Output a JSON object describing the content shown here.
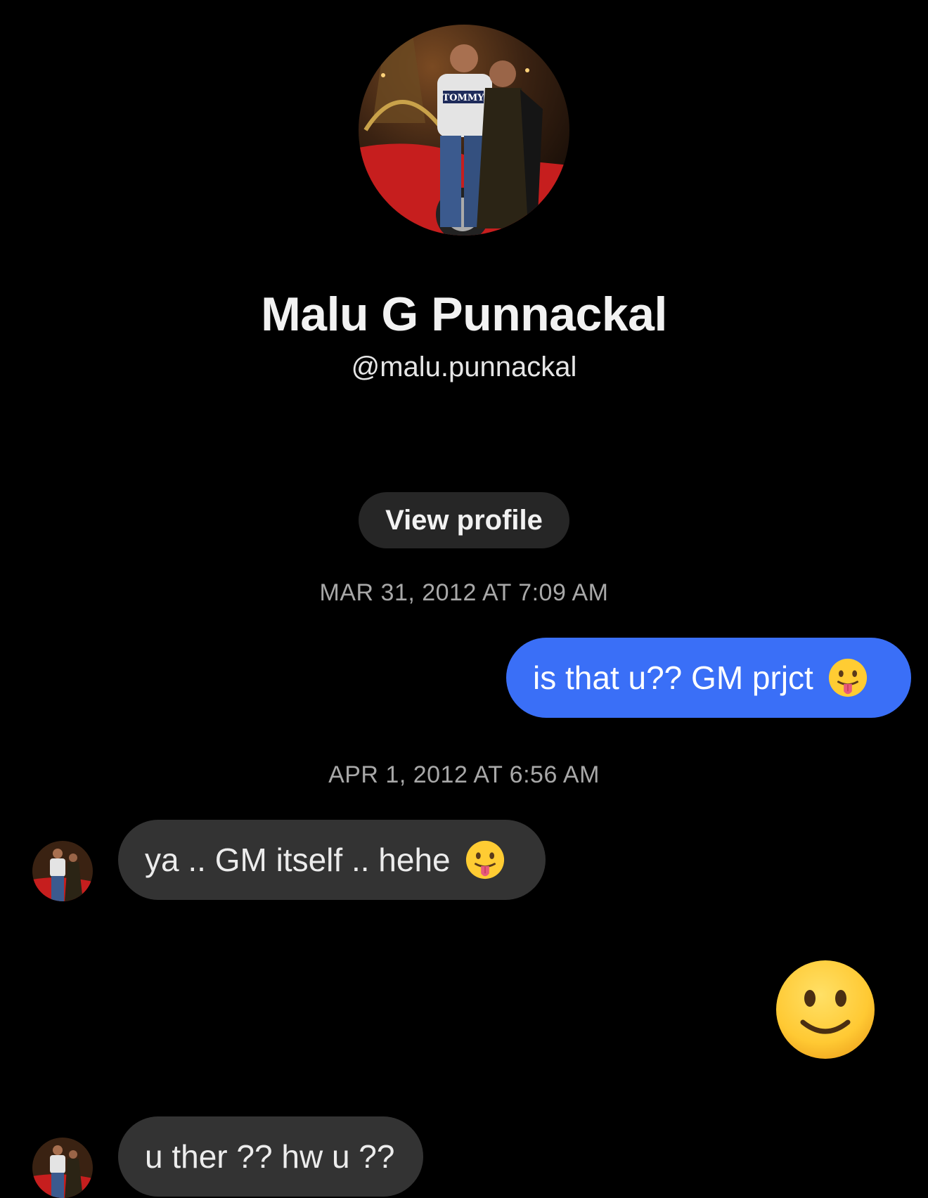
{
  "profile": {
    "name": "Malu G Punnackal",
    "handle": "@malu.punnackal",
    "photo_text": "TOMMY",
    "view_profile_label": "View profile"
  },
  "messages": [
    {
      "type": "timestamp",
      "text": "MAR 31, 2012 AT 7:09 AM"
    },
    {
      "type": "sent",
      "text": "is that u?? GM prjct",
      "emoji": "face-with-tongue"
    },
    {
      "type": "timestamp",
      "text": "APR 1, 2012 AT 6:56 AM"
    },
    {
      "type": "received",
      "text": "ya .. GM itself .. hehe",
      "emoji": "face-with-tongue"
    },
    {
      "type": "sent-emoji",
      "emoji": "slightly-smiling-face"
    },
    {
      "type": "received",
      "text": "u ther ?? hw u ??"
    }
  ],
  "colors": {
    "background": "#000000",
    "sent_bubble": "#3a6ff7",
    "received_bubble": "#333333",
    "button_bg": "#262626",
    "timestamp": "#a8a8a8"
  }
}
